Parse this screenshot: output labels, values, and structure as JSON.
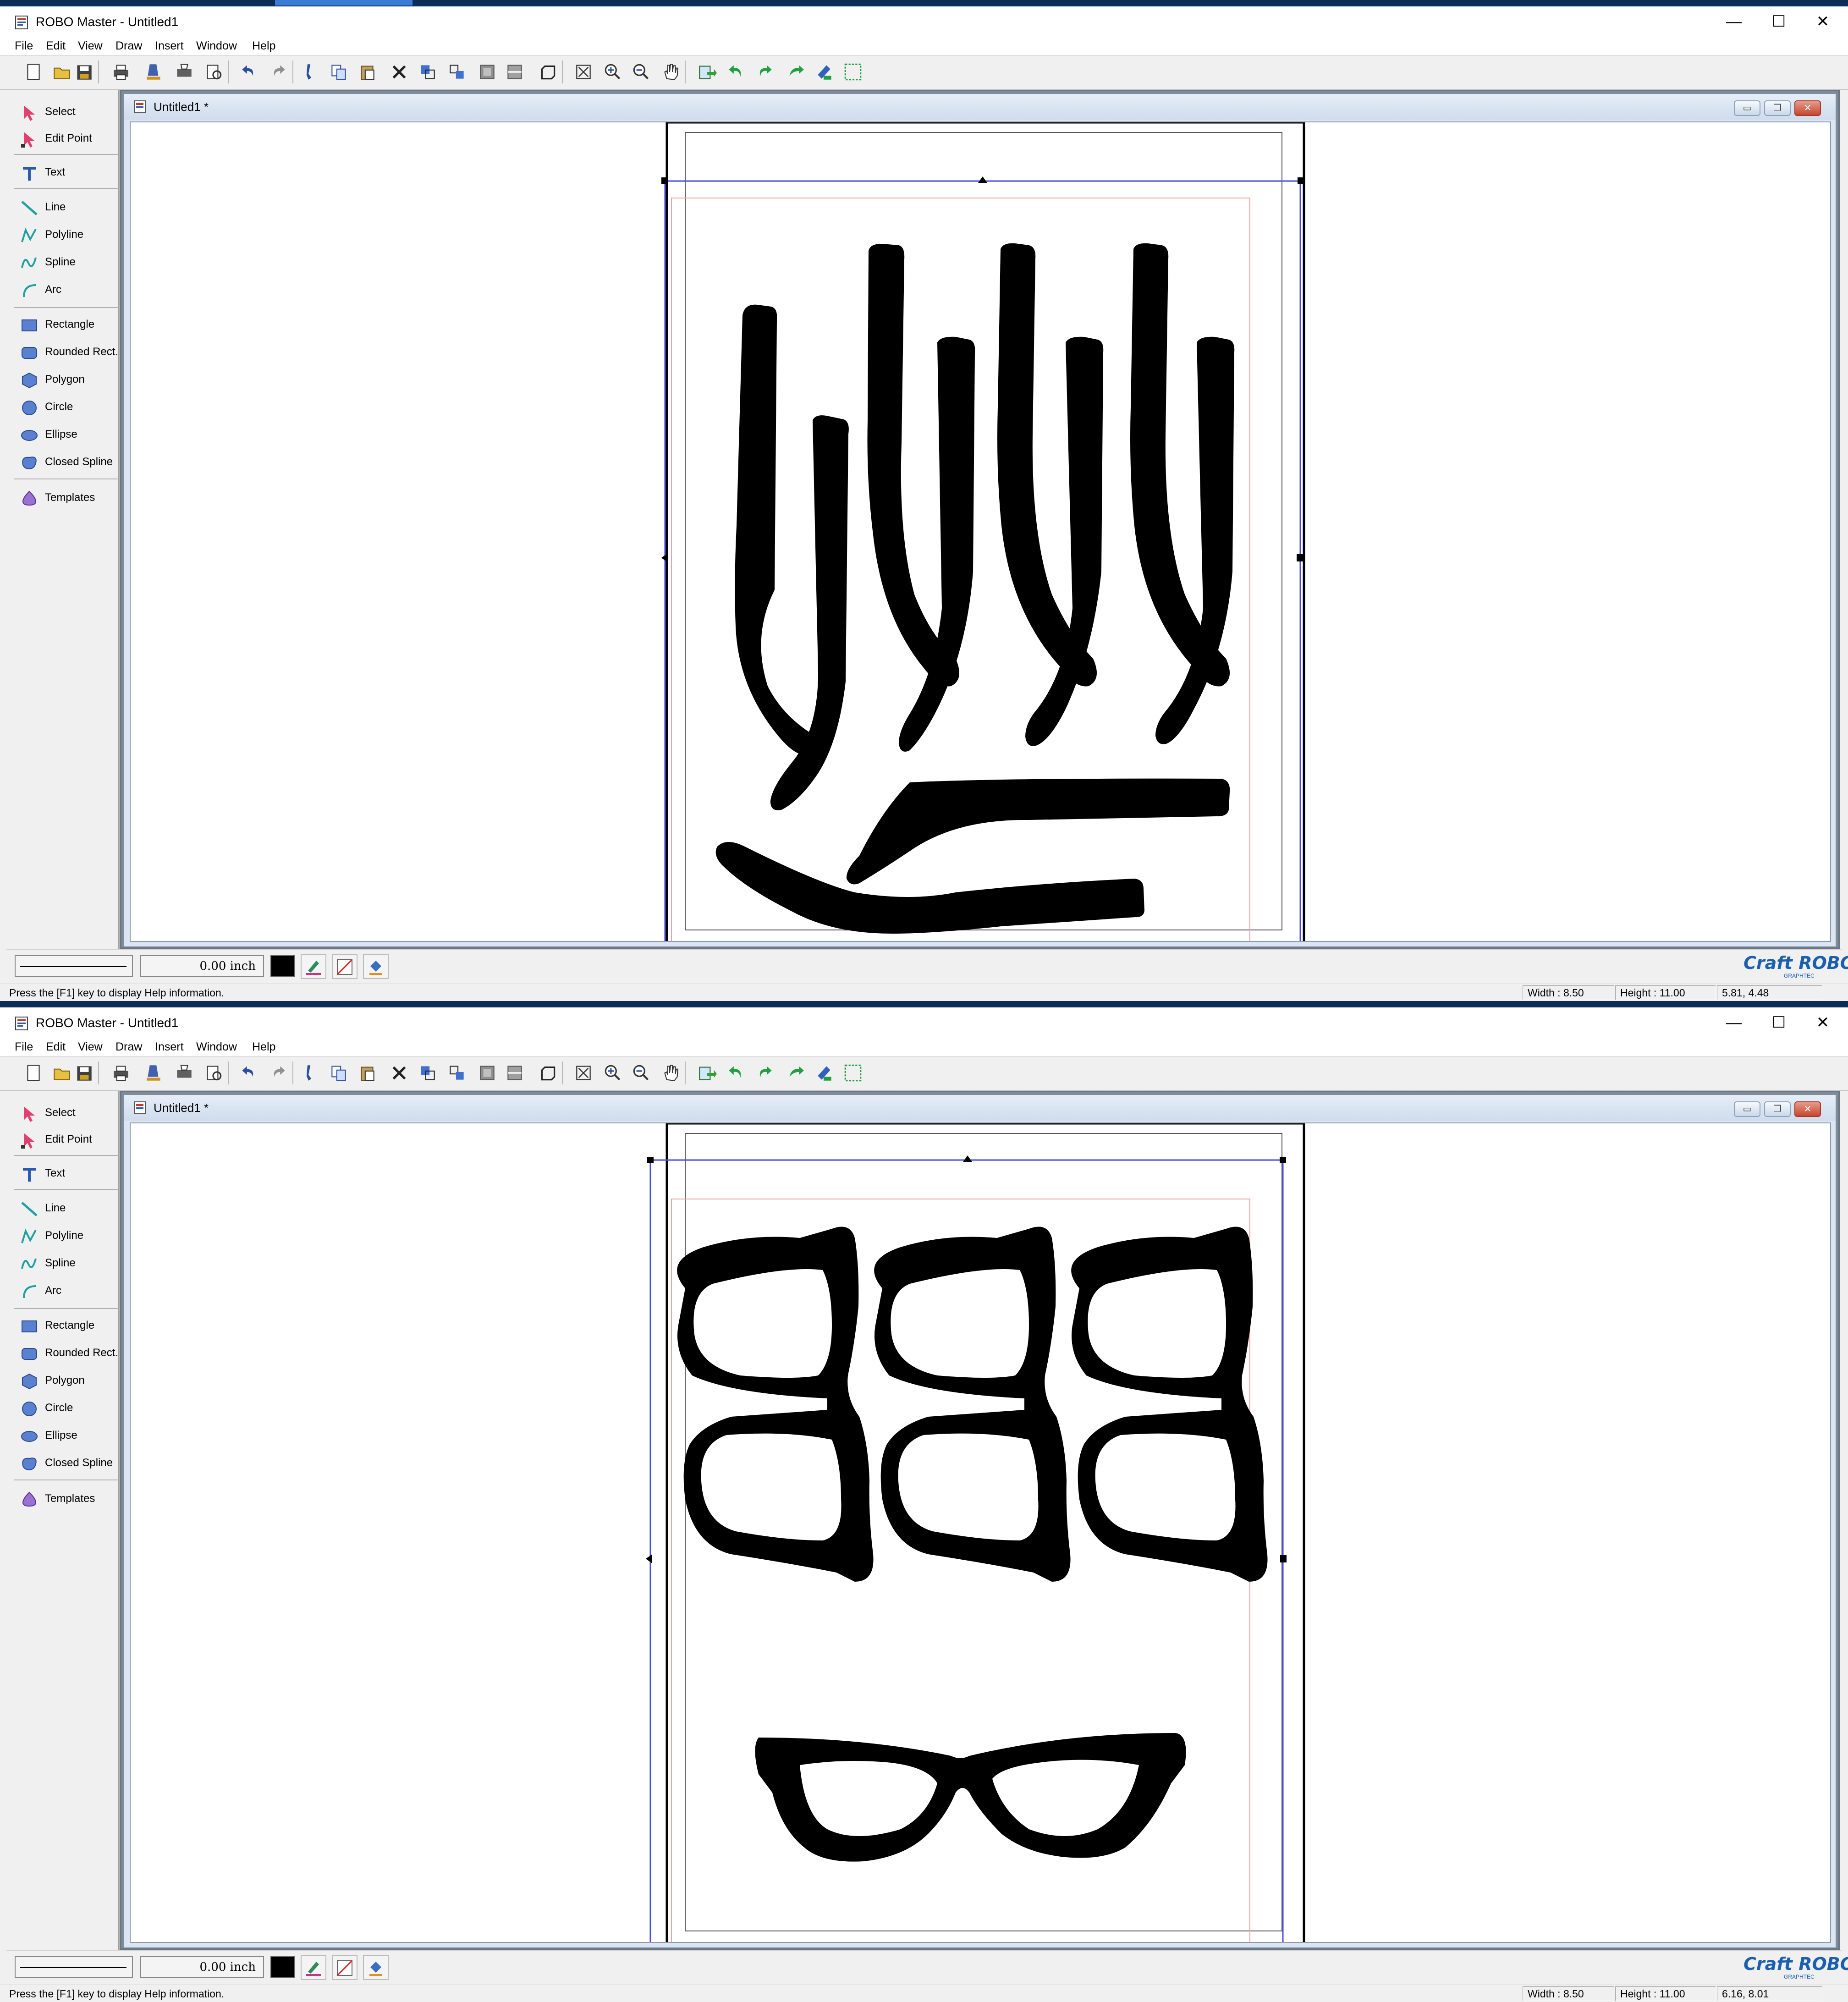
{
  "app": {
    "title": "ROBO Master - Untitled1",
    "window_controls": {
      "minimize": "—",
      "maximize": "☐",
      "close": "✕"
    }
  },
  "menu": [
    "File",
    "Edit",
    "View",
    "Draw",
    "Insert",
    "Window",
    "Help"
  ],
  "toolbar_icons": [
    "new-icon",
    "open-icon",
    "save-icon",
    "print-icon",
    "cut-settings-icon",
    "plot-icon",
    "print-preview-icon",
    "undo-icon",
    "redo-icon",
    "cut-icon",
    "copy-icon",
    "paste-icon",
    "delete-icon",
    "group-icon",
    "ungroup-icon",
    "align-icon",
    "distribute-icon",
    "bring-front-icon",
    "zoom-all-icon",
    "zoom-in-icon",
    "zoom-out-icon",
    "pan-icon",
    "import-icon",
    "rotate-left-icon",
    "rotate-right-icon",
    "flip-icon",
    "trace-icon",
    "registration-marks-icon"
  ],
  "tools": [
    {
      "label": "Select",
      "icon": "select-arrow-icon"
    },
    {
      "label": "Edit Point",
      "icon": "edit-point-icon"
    },
    {
      "label": "Text",
      "icon": "text-tool-icon"
    },
    {
      "label": "Line",
      "icon": "line-tool-icon"
    },
    {
      "label": "Polyline",
      "icon": "polyline-tool-icon"
    },
    {
      "label": "Spline",
      "icon": "spline-tool-icon"
    },
    {
      "label": "Arc",
      "icon": "arc-tool-icon"
    },
    {
      "label": "Rectangle",
      "icon": "rectangle-tool-icon"
    },
    {
      "label": "Rounded Rect.",
      "icon": "rounded-rect-tool-icon"
    },
    {
      "label": "Polygon",
      "icon": "polygon-tool-icon"
    },
    {
      "label": "Circle",
      "icon": "circle-tool-icon"
    },
    {
      "label": "Ellipse",
      "icon": "ellipse-tool-icon"
    },
    {
      "label": "Closed Spline",
      "icon": "closed-spline-tool-icon"
    },
    {
      "label": "Templates",
      "icon": "templates-icon"
    }
  ],
  "document": {
    "title": "Untitled1 *",
    "child_controls": {
      "minimize": "▭",
      "restore": "❐",
      "close": "✕"
    }
  },
  "properties": {
    "line_width": "0.00 inch",
    "fill_color": "#000000"
  },
  "logo": {
    "text": "Craft ROBO",
    "sub": "GRAPHTEC"
  },
  "colors": {
    "accent_blue": "#1a5fb0",
    "selection_box": "#4a4adf",
    "margin_line": "#f0a0a0",
    "shape_fill": "#000000"
  },
  "windows": [
    {
      "status": {
        "hint": "Press the [F1] key to display Help information.",
        "width": "Width : 8.50",
        "height": "Height : 11.00",
        "coords": "5.81, 4.48"
      },
      "canvas_content": "eyeglass-temple-arms"
    },
    {
      "status": {
        "hint": "Press the [F1] key to display Help information.",
        "width": "Width : 8.50",
        "height": "Height : 11.00",
        "coords": "6.16, 8.01"
      },
      "canvas_content": "eyeglass-frames"
    }
  ]
}
